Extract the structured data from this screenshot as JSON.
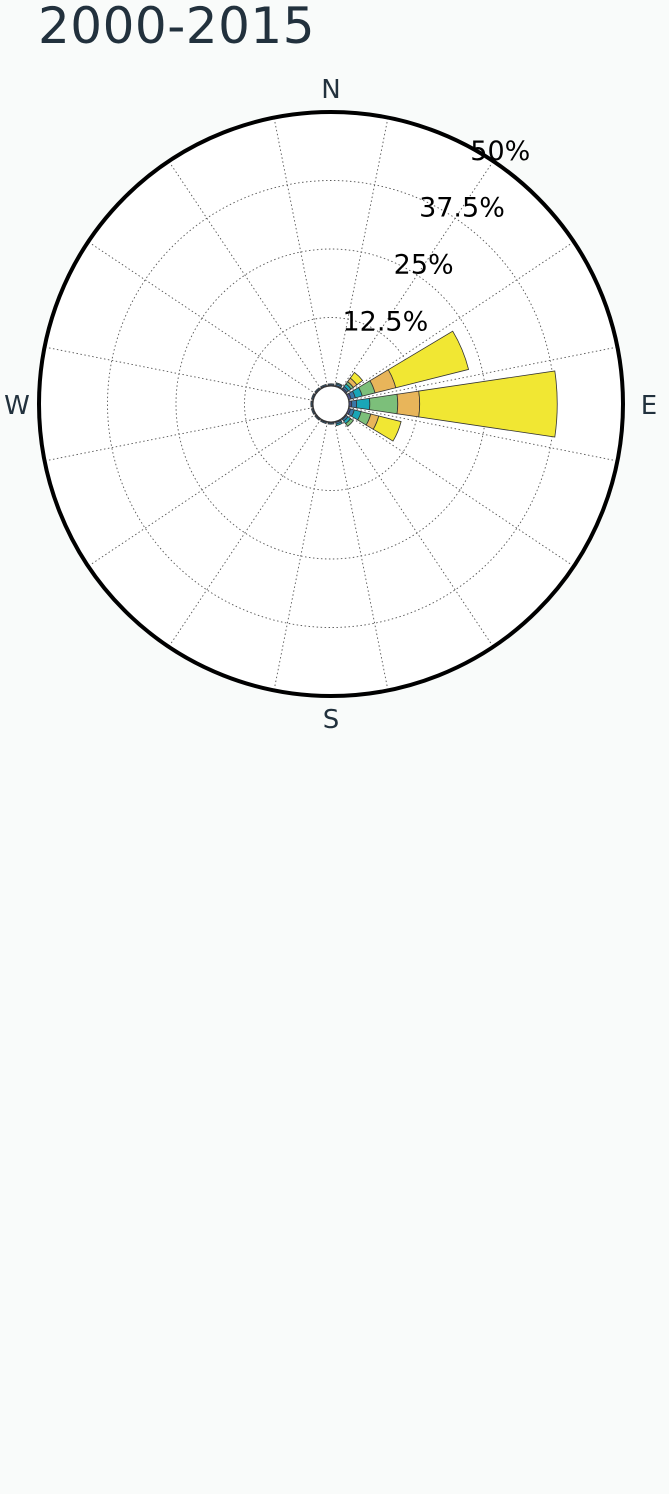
{
  "header": {
    "title": "2000-2015"
  },
  "chart_data": {
    "type": "polar-bar",
    "title": "2000-2015",
    "directions": [
      "N",
      "E",
      "S",
      "W"
    ],
    "radial_ticks": [
      "12.5%",
      "25%",
      "37.5%",
      "50%"
    ],
    "radial_tick_values": [
      12.5,
      25,
      37.5,
      50
    ],
    "rlim": [
      0,
      50
    ],
    "sectors": 16,
    "grid": true,
    "bin_colors": [
      "#4a4f87",
      "#3a78a8",
      "#1aa6b7",
      "#7cbf7a",
      "#e8b55a",
      "#f1e733"
    ],
    "bars": [
      {
        "direction_deg": 67.5,
        "stack": [
          0.5,
          0.8,
          1.3,
          2.4,
          3.9,
          13.7
        ]
      },
      {
        "direction_deg": 90,
        "stack": [
          0.5,
          0.9,
          2.4,
          5.1,
          4.0,
          25.1
        ]
      },
      {
        "direction_deg": 112.5,
        "stack": [
          0.4,
          0.7,
          1.3,
          1.8,
          1.5,
          4.2
        ]
      },
      {
        "direction_deg": 45,
        "stack": [
          0.3,
          0.4,
          0.6,
          0.5,
          0.8,
          1.3
        ]
      },
      {
        "direction_deg": 135,
        "stack": [
          0.2,
          0.4,
          0.6,
          0.6,
          0.0,
          0.0
        ]
      },
      {
        "direction_deg": 157.5,
        "stack": [
          0.2,
          0.3,
          0.3,
          0.0,
          0.0,
          0.0
        ]
      },
      {
        "direction_deg": 22.5,
        "stack": [
          0.2,
          0.3,
          0.2,
          0.0,
          0.0,
          0.0
        ]
      },
      {
        "direction_deg": 0,
        "stack": [
          0.2,
          0.2,
          0.0,
          0.0,
          0.0,
          0.0
        ]
      },
      {
        "direction_deg": 180,
        "stack": [
          0.2,
          0.2,
          0.0,
          0.0,
          0.0,
          0.0
        ]
      },
      {
        "direction_deg": 202.5,
        "stack": [
          0.2,
          0.2,
          0.0,
          0.0,
          0.0,
          0.0
        ]
      },
      {
        "direction_deg": 225,
        "stack": [
          0.2,
          0.2,
          0.0,
          0.0,
          0.0,
          0.0
        ]
      },
      {
        "direction_deg": 247.5,
        "stack": [
          0.2,
          0.2,
          0.0,
          0.0,
          0.0,
          0.0
        ]
      },
      {
        "direction_deg": 270,
        "stack": [
          0.2,
          0.2,
          0.0,
          0.0,
          0.0,
          0.0
        ]
      },
      {
        "direction_deg": 292.5,
        "stack": [
          0.2,
          0.2,
          0.0,
          0.0,
          0.0,
          0.0
        ]
      },
      {
        "direction_deg": 315,
        "stack": [
          0.2,
          0.2,
          0.0,
          0.0,
          0.0,
          0.0
        ]
      },
      {
        "direction_deg": 337.5,
        "stack": [
          0.2,
          0.2,
          0.0,
          0.0,
          0.0,
          0.0
        ]
      }
    ]
  }
}
